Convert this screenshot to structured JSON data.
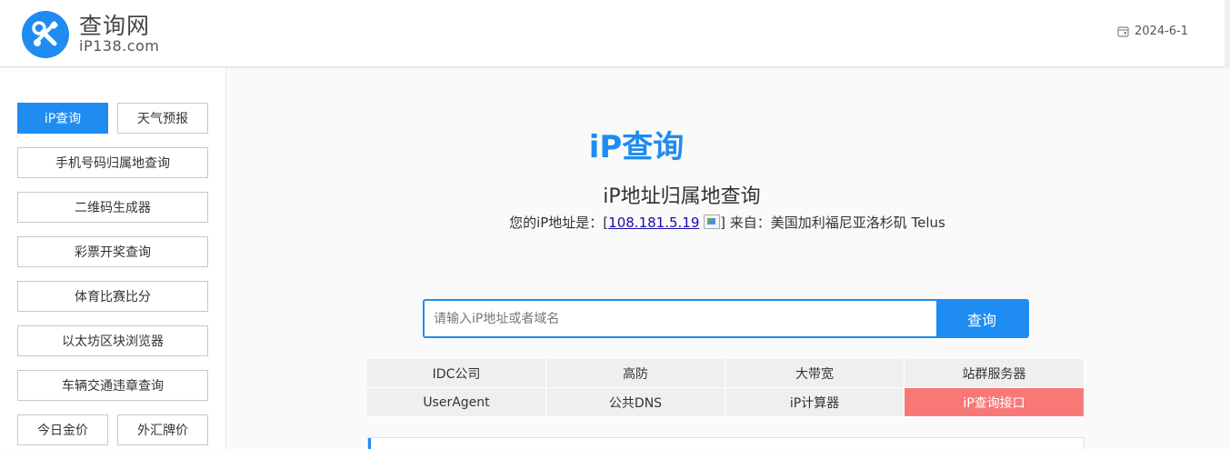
{
  "header": {
    "title": "查询网",
    "subtitle": "iP138.com",
    "date": "2024-6-1"
  },
  "sidebar": {
    "items": [
      {
        "label": "iP查询",
        "active": true
      },
      {
        "label": "天气预报"
      },
      {
        "label": "手机号码归属地查询"
      },
      {
        "label": "二维码生成器"
      },
      {
        "label": "彩票开奖查询"
      },
      {
        "label": "体育比赛比分"
      },
      {
        "label": "以太坊区块浏览器"
      },
      {
        "label": "车辆交通违章查询"
      },
      {
        "label": "今日金价"
      },
      {
        "label": "外汇牌价"
      }
    ]
  },
  "main": {
    "title": "iP查询",
    "subtitle": "iP地址归属地查询",
    "ip_prefix": "您的iP地址是：[",
    "ip_address": "108.181.5.19",
    "ip_suffix": "] 来自：美国加利福尼亚洛杉矶 Telus",
    "search": {
      "placeholder": "请输入iP地址或者域名",
      "button": "查询"
    },
    "links": [
      "IDC公司",
      "高防",
      "大带宽",
      "站群服务器",
      "UserAgent",
      "公共DNS",
      "iP计算器",
      "iP查询接口"
    ]
  },
  "colors": {
    "accent": "#1e8cf0",
    "highlight": "#f87878"
  }
}
